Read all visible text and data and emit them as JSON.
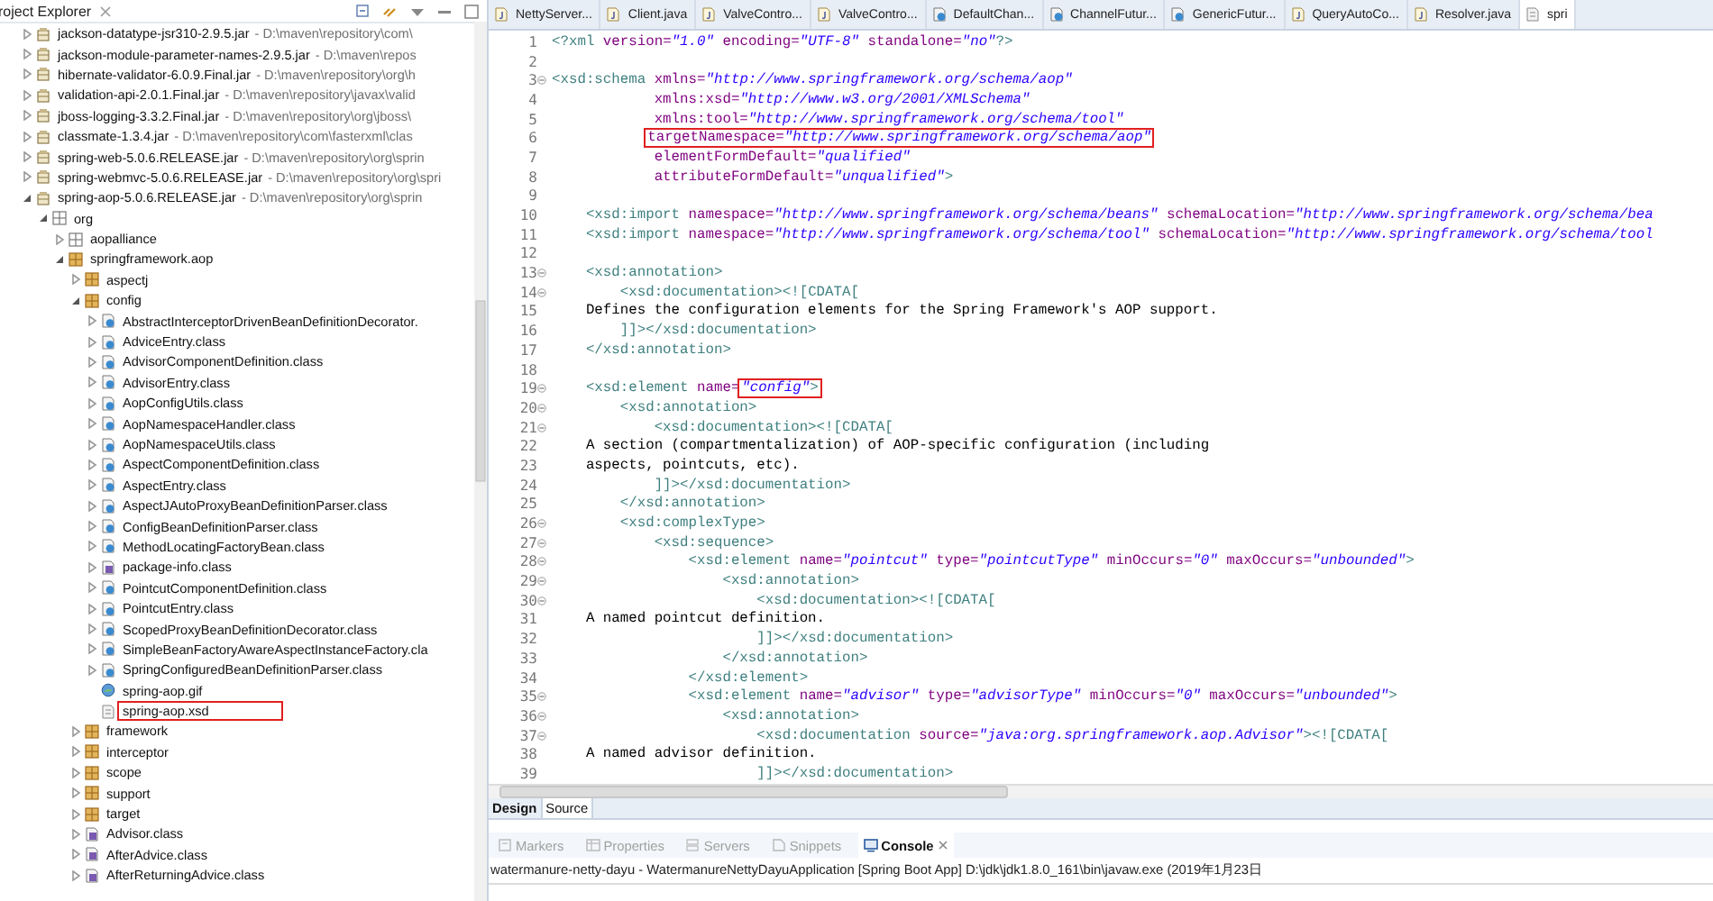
{
  "explorer": {
    "title": "roject Explorer",
    "tree": [
      {
        "label": "jackson-datatype-jsr310-2.9.5.jar",
        "path": "- D:\\maven\\repository\\com\\",
        "kind": "jar",
        "expanded": false
      },
      {
        "label": "jackson-module-parameter-names-2.9.5.jar",
        "path": "- D:\\maven\\repos",
        "kind": "jar",
        "expanded": false
      },
      {
        "label": "hibernate-validator-6.0.9.Final.jar",
        "path": "- D:\\maven\\repository\\org\\h",
        "kind": "jar",
        "expanded": false
      },
      {
        "label": "validation-api-2.0.1.Final.jar",
        "path": "- D:\\maven\\repository\\javax\\valid",
        "kind": "jar",
        "expanded": false
      },
      {
        "label": "jboss-logging-3.3.2.Final.jar",
        "path": "- D:\\maven\\repository\\org\\jboss\\",
        "kind": "jar",
        "expanded": false
      },
      {
        "label": "classmate-1.3.4.jar",
        "path": "- D:\\maven\\repository\\com\\fasterxml\\clas",
        "kind": "jar",
        "expanded": false
      },
      {
        "label": "spring-web-5.0.6.RELEASE.jar",
        "path": "- D:\\maven\\repository\\org\\sprin",
        "kind": "jar",
        "expanded": false
      },
      {
        "label": "spring-webmvc-5.0.6.RELEASE.jar",
        "path": "- D:\\maven\\repository\\org\\spri",
        "kind": "jar",
        "expanded": false
      },
      {
        "label": "spring-aop-5.0.6.RELEASE.jar",
        "path": "- D:\\maven\\repository\\org\\sprin",
        "kind": "jar",
        "expanded": true,
        "children": [
          {
            "label": "org",
            "kind": "empty-package",
            "expanded": true,
            "children": [
              {
                "label": "aopalliance",
                "kind": "empty-package",
                "expanded": false
              },
              {
                "label": "springframework.aop",
                "kind": "package",
                "expanded": true,
                "children": [
                  {
                    "label": "aspectj",
                    "kind": "package",
                    "expanded": false
                  },
                  {
                    "label": "config",
                    "kind": "package",
                    "expanded": true,
                    "children": [
                      {
                        "label": "AbstractInterceptorDrivenBeanDefinitionDecorator.",
                        "kind": "class",
                        "expanded": false
                      },
                      {
                        "label": "AdviceEntry.class",
                        "kind": "class",
                        "expanded": false
                      },
                      {
                        "label": "AdvisorComponentDefinition.class",
                        "kind": "class",
                        "expanded": false
                      },
                      {
                        "label": "AdvisorEntry.class",
                        "kind": "class",
                        "expanded": false
                      },
                      {
                        "label": "AopConfigUtils.class",
                        "kind": "class",
                        "expanded": false
                      },
                      {
                        "label": "AopNamespaceHandler.class",
                        "kind": "class",
                        "expanded": false
                      },
                      {
                        "label": "AopNamespaceUtils.class",
                        "kind": "class",
                        "expanded": false
                      },
                      {
                        "label": "AspectComponentDefinition.class",
                        "kind": "class",
                        "expanded": false
                      },
                      {
                        "label": "AspectEntry.class",
                        "kind": "class",
                        "expanded": false
                      },
                      {
                        "label": "AspectJAutoProxyBeanDefinitionParser.class",
                        "kind": "class",
                        "expanded": false
                      },
                      {
                        "label": "ConfigBeanDefinitionParser.class",
                        "kind": "class",
                        "expanded": false
                      },
                      {
                        "label": "MethodLocatingFactoryBean.class",
                        "kind": "class",
                        "expanded": false
                      },
                      {
                        "label": "package-info.class",
                        "kind": "interface",
                        "expanded": false
                      },
                      {
                        "label": "PointcutComponentDefinition.class",
                        "kind": "class",
                        "expanded": false
                      },
                      {
                        "label": "PointcutEntry.class",
                        "kind": "class",
                        "expanded": false
                      },
                      {
                        "label": "ScopedProxyBeanDefinitionDecorator.class",
                        "kind": "class",
                        "expanded": false
                      },
                      {
                        "label": "SimpleBeanFactoryAwareAspectInstanceFactory.cla",
                        "kind": "class",
                        "expanded": false
                      },
                      {
                        "label": "SpringConfiguredBeanDefinitionParser.class",
                        "kind": "class",
                        "expanded": false
                      },
                      {
                        "label": "spring-aop.gif",
                        "kind": "image"
                      },
                      {
                        "label": "spring-aop.xsd",
                        "kind": "xsd",
                        "highlighted": true
                      }
                    ]
                  },
                  {
                    "label": "framework",
                    "kind": "package",
                    "expanded": false
                  },
                  {
                    "label": "interceptor",
                    "kind": "package",
                    "expanded": false
                  },
                  {
                    "label": "scope",
                    "kind": "package",
                    "expanded": false
                  },
                  {
                    "label": "support",
                    "kind": "package",
                    "expanded": false
                  },
                  {
                    "label": "target",
                    "kind": "package",
                    "expanded": false
                  },
                  {
                    "label": "Advisor.class",
                    "kind": "interface",
                    "expanded": false
                  },
                  {
                    "label": "AfterAdvice.class",
                    "kind": "interface",
                    "expanded": false
                  },
                  {
                    "label": "AfterReturningAdvice.class",
                    "kind": "interface",
                    "expanded": false
                  }
                ]
              }
            ]
          }
        ]
      }
    ]
  },
  "editor_tabs": [
    {
      "label": "NettyServer...",
      "kind": "java",
      "selected": false
    },
    {
      "label": "Client.java",
      "kind": "java",
      "selected": false
    },
    {
      "label": "ValveContro...",
      "kind": "java",
      "selected": false
    },
    {
      "label": "ValveContro...",
      "kind": "java",
      "selected": false
    },
    {
      "label": "DefaultChan...",
      "kind": "class",
      "selected": false
    },
    {
      "label": "ChannelFutur...",
      "kind": "class",
      "selected": false
    },
    {
      "label": "GenericFutur...",
      "kind": "class",
      "selected": false
    },
    {
      "label": "QueryAutoCo...",
      "kind": "java",
      "selected": false
    },
    {
      "label": "Resolver.java",
      "kind": "java",
      "selected": false
    },
    {
      "label": "spri",
      "kind": "xsd",
      "selected": true
    }
  ],
  "code_lines": [
    {
      "number": "1",
      "fold": false,
      "tokens": [
        {
          "kind": "tag",
          "text": "<?xml "
        },
        {
          "kind": "attr",
          "text": "version="
        },
        {
          "kind": "value",
          "text": "\"1.0\""
        },
        {
          "kind": "attr",
          "text": " encoding="
        },
        {
          "kind": "value",
          "text": "\"UTF-8\""
        },
        {
          "kind": "attr",
          "text": " standalone="
        },
        {
          "kind": "value",
          "text": "\"no\""
        },
        {
          "kind": "tag",
          "text": "?>"
        }
      ]
    },
    {
      "number": "2",
      "fold": false
    },
    {
      "number": "3",
      "fold": true,
      "tokens": [
        {
          "kind": "tag",
          "text": "<xsd:schema "
        },
        {
          "kind": "attr",
          "text": "xmlns="
        },
        {
          "kind": "value",
          "text": "\"http://www.springframework.org/schema/aop\""
        }
      ]
    },
    {
      "number": "4",
      "fold": false,
      "tokens": [
        {
          "kind": "attr",
          "text": "            xmlns:xsd="
        },
        {
          "kind": "value",
          "text": "\"http://www.w3.org/2001/XMLSchema\""
        }
      ]
    },
    {
      "number": "5",
      "fold": false,
      "tokens": [
        {
          "kind": "attr",
          "text": "            xmlns:tool="
        },
        {
          "kind": "value",
          "text": "\"http://www.springframework.org/schema/tool\""
        }
      ]
    },
    {
      "number": "6",
      "fold": false,
      "tokens": [
        {
          "kind": "box",
          "tokens": [
            {
              "kind": "attr",
              "text": "           targetNamespace="
            },
            {
              "kind": "value",
              "text": "\"http://www.springframework.org/schema/aop\""
            }
          ]
        }
      ]
    },
    {
      "number": "7",
      "fold": false,
      "tokens": [
        {
          "kind": "attr",
          "text": "            elementFormDefault="
        },
        {
          "kind": "value",
          "text": "\"qualified\""
        }
      ]
    },
    {
      "number": "8",
      "fold": false,
      "tokens": [
        {
          "kind": "attr",
          "text": "            attributeFormDefault="
        },
        {
          "kind": "value",
          "text": "\"unqualified\""
        },
        {
          "kind": "tag",
          "text": ">"
        }
      ]
    },
    {
      "number": "9",
      "fold": false
    },
    {
      "number": "10",
      "fold": false,
      "tokens": [
        {
          "kind": "tag",
          "text": "    <xsd:import "
        },
        {
          "kind": "attr",
          "text": "namespace="
        },
        {
          "kind": "value",
          "text": "\"http://www.springframework.org/schema/beans\""
        },
        {
          "kind": "attr",
          "text": " schemaLocation="
        },
        {
          "kind": "value",
          "text": "\"http://www.springframework.org/schema/bea"
        }
      ]
    },
    {
      "number": "11",
      "fold": false,
      "tokens": [
        {
          "kind": "tag",
          "text": "    <xsd:import "
        },
        {
          "kind": "attr",
          "text": "namespace="
        },
        {
          "kind": "value",
          "text": "\"http://www.springframework.org/schema/tool\""
        },
        {
          "kind": "attr",
          "text": " schemaLocation="
        },
        {
          "kind": "value",
          "text": "\"http://www.springframework.org/schema/tool"
        }
      ]
    },
    {
      "number": "12",
      "fold": false
    },
    {
      "number": "13",
      "fold": true,
      "tokens": [
        {
          "kind": "tag",
          "text": "    <xsd:annotation>"
        }
      ]
    },
    {
      "number": "14",
      "fold": true,
      "tokens": [
        {
          "kind": "tag",
          "text": "        <xsd:documentation>"
        },
        {
          "kind": "cdata",
          "text": "<![CDATA["
        }
      ]
    },
    {
      "number": "15",
      "fold": false,
      "tokens": [
        {
          "kind": "text",
          "text": "    Defines the configuration elements for the Spring Framework's AOP support."
        }
      ]
    },
    {
      "number": "16",
      "fold": false,
      "tokens": [
        {
          "kind": "cdata",
          "text": "        ]]>"
        },
        {
          "kind": "tag",
          "text": "</xsd:documentation>"
        }
      ]
    },
    {
      "number": "17",
      "fold": false,
      "tokens": [
        {
          "kind": "tag",
          "text": "    </xsd:annotation>"
        }
      ]
    },
    {
      "number": "18",
      "fold": false
    },
    {
      "number": "19",
      "fold": true,
      "tokens": [
        {
          "kind": "tag",
          "text": "    <xsd:element "
        },
        {
          "kind": "attr",
          "text": "name="
        },
        {
          "kind": "box",
          "tokens": [
            {
              "kind": "value",
              "text": "\"config\""
            },
            {
              "kind": "tag",
              "text": ">"
            }
          ]
        }
      ]
    },
    {
      "number": "20",
      "fold": true,
      "tokens": [
        {
          "kind": "tag",
          "text": "        <xsd:annotation>"
        }
      ]
    },
    {
      "number": "21",
      "fold": true,
      "tokens": [
        {
          "kind": "tag",
          "text": "            <xsd:documentation>"
        },
        {
          "kind": "cdata",
          "text": "<![CDATA["
        }
      ]
    },
    {
      "number": "22",
      "fold": false,
      "tokens": [
        {
          "kind": "text",
          "text": "    A section (compartmentalization) of AOP-specific configuration (including"
        }
      ]
    },
    {
      "number": "23",
      "fold": false,
      "tokens": [
        {
          "kind": "text",
          "text": "    aspects, pointcuts, etc)."
        }
      ]
    },
    {
      "number": "24",
      "fold": false,
      "tokens": [
        {
          "kind": "cdata",
          "text": "            ]]>"
        },
        {
          "kind": "tag",
          "text": "</xsd:documentation>"
        }
      ]
    },
    {
      "number": "25",
      "fold": false,
      "tokens": [
        {
          "kind": "tag",
          "text": "        </xsd:annotation>"
        }
      ]
    },
    {
      "number": "26",
      "fold": true,
      "tokens": [
        {
          "kind": "tag",
          "text": "        <xsd:complexType>"
        }
      ]
    },
    {
      "number": "27",
      "fold": true,
      "tokens": [
        {
          "kind": "tag",
          "text": "            <xsd:sequence>"
        }
      ]
    },
    {
      "number": "28",
      "fold": true,
      "tokens": [
        {
          "kind": "tag",
          "text": "                <xsd:element "
        },
        {
          "kind": "attr",
          "text": "name="
        },
        {
          "kind": "value",
          "text": "\"pointcut\""
        },
        {
          "kind": "attr",
          "text": " type="
        },
        {
          "kind": "value",
          "text": "\"pointcutType\""
        },
        {
          "kind": "attr",
          "text": " minOccurs="
        },
        {
          "kind": "value",
          "text": "\"0\""
        },
        {
          "kind": "attr",
          "text": " maxOccurs="
        },
        {
          "kind": "value",
          "text": "\"unbounded\""
        },
        {
          "kind": "tag",
          "text": ">"
        }
      ]
    },
    {
      "number": "29",
      "fold": true,
      "tokens": [
        {
          "kind": "tag",
          "text": "                    <xsd:annotation>"
        }
      ]
    },
    {
      "number": "30",
      "fold": true,
      "tokens": [
        {
          "kind": "tag",
          "text": "                        <xsd:documentation>"
        },
        {
          "kind": "cdata",
          "text": "<![CDATA["
        }
      ]
    },
    {
      "number": "31",
      "fold": false,
      "tokens": [
        {
          "kind": "text",
          "text": "    A named pointcut definition."
        }
      ]
    },
    {
      "number": "32",
      "fold": false,
      "tokens": [
        {
          "kind": "cdata",
          "text": "                        ]]>"
        },
        {
          "kind": "tag",
          "text": "</xsd:documentation>"
        }
      ]
    },
    {
      "number": "33",
      "fold": false,
      "tokens": [
        {
          "kind": "tag",
          "text": "                    </xsd:annotation>"
        }
      ]
    },
    {
      "number": "34",
      "fold": false,
      "tokens": [
        {
          "kind": "tag",
          "text": "                </xsd:element>"
        }
      ]
    },
    {
      "number": "35",
      "fold": true,
      "tokens": [
        {
          "kind": "tag",
          "text": "                <xsd:element "
        },
        {
          "kind": "attr",
          "text": "name="
        },
        {
          "kind": "value",
          "text": "\"advisor\""
        },
        {
          "kind": "attr",
          "text": " type="
        },
        {
          "kind": "value",
          "text": "\"advisorType\""
        },
        {
          "kind": "attr",
          "text": " minOccurs="
        },
        {
          "kind": "value",
          "text": "\"0\""
        },
        {
          "kind": "attr",
          "text": " maxOccurs="
        },
        {
          "kind": "value",
          "text": "\"unbounded\""
        },
        {
          "kind": "tag",
          "text": ">"
        }
      ]
    },
    {
      "number": "36",
      "fold": true,
      "tokens": [
        {
          "kind": "tag",
          "text": "                    <xsd:annotation>"
        }
      ]
    },
    {
      "number": "37",
      "fold": true,
      "tokens": [
        {
          "kind": "tag",
          "text": "                        <xsd:documentation "
        },
        {
          "kind": "attr",
          "text": "source="
        },
        {
          "kind": "value",
          "text": "\"java:org.springframework.aop.Advisor\""
        },
        {
          "kind": "tag",
          "text": ">"
        },
        {
          "kind": "cdata",
          "text": "<![CDATA["
        }
      ]
    },
    {
      "number": "38",
      "fold": false,
      "tokens": [
        {
          "kind": "text",
          "text": "    A named advisor definition."
        }
      ]
    },
    {
      "number": "39",
      "fold": false,
      "tokens": [
        {
          "kind": "cdata",
          "text": "                        ]]>"
        },
        {
          "kind": "tag",
          "text": "</xsd:documentation>"
        }
      ]
    }
  ],
  "mode_tabs": [
    {
      "label": "Design",
      "selected": false
    },
    {
      "label": "Source",
      "selected": true
    }
  ],
  "view_tabs": [
    {
      "label": "Markers",
      "kind": "markers",
      "selected": false
    },
    {
      "label": "Properties",
      "kind": "properties",
      "selected": false
    },
    {
      "label": "Servers",
      "kind": "servers",
      "selected": false
    },
    {
      "label": "Snippets",
      "kind": "snippets",
      "selected": false
    },
    {
      "label": "Console",
      "kind": "console",
      "selected": true
    }
  ],
  "console": {
    "header": "watermanure-netty-dayu - WatermanureNettyDayuApplication [Spring Boot App] D:\\jdk\\jdk1.8.0_161\\bin\\javaw.exe (2019年1月23日"
  }
}
